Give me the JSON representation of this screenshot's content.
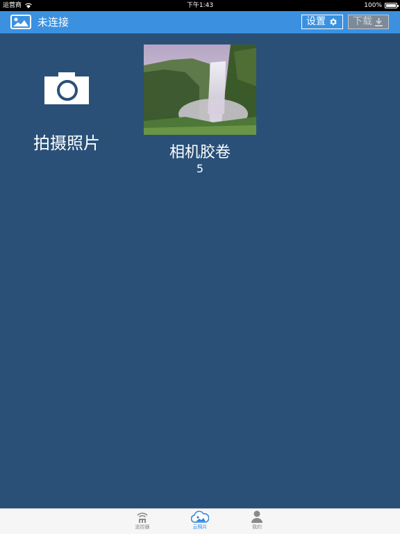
{
  "status_bar": {
    "carrier": "运营商",
    "time": "下午1:43",
    "battery": "100%"
  },
  "nav": {
    "title": "未连接",
    "settings_label": "设置",
    "download_label": "下载"
  },
  "tiles": {
    "capture": {
      "label": "拍摄照片"
    },
    "camera_roll": {
      "label": "相机胶卷",
      "count": "5"
    }
  },
  "tabs": [
    {
      "label": "遥控器",
      "icon": "remote-control-icon",
      "active": false
    },
    {
      "label": "云照片",
      "icon": "cloud-photo-icon",
      "active": true
    },
    {
      "label": "我的",
      "icon": "person-icon",
      "active": false
    }
  ],
  "colors": {
    "background": "#2a5078",
    "nav_bar": "#3b91e0",
    "tab_active": "#2e86de",
    "tab_inactive": "#8a8a8a"
  }
}
